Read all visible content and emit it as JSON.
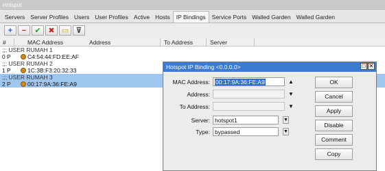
{
  "window": {
    "title": "Hotspot"
  },
  "tabs": [
    "Servers",
    "Server Profiles",
    "Users",
    "User Profiles",
    "Active",
    "Hosts",
    "IP Bindings",
    "Service Ports",
    "Walled Garden",
    "Walled Garden"
  ],
  "active_tab": "IP Bindings",
  "toolbar": {
    "add": "+",
    "remove": "−",
    "enable": "✔",
    "disable": "✖",
    "comment": "▭",
    "filter": "⊽"
  },
  "grid": {
    "headers": [
      "#",
      "MAC Address",
      "Address",
      "To Address",
      "Server"
    ],
    "rows": [
      {
        "comment": ";;; USER RUMAH 1",
        "num": "0",
        "flag": "P",
        "mac": "C4:54:44:FD:EE:AF"
      },
      {
        "comment": ";;; USER RUMAH 2",
        "num": "1",
        "flag": "P",
        "mac": "1C:3B:F3:20:32:33"
      },
      {
        "comment": ";;; USER RUMAH 3",
        "num": "2",
        "flag": "P",
        "mac": "00:17:9A:36:FE:A9"
      }
    ]
  },
  "dialog": {
    "title": "Hotspot IP Binding <0.0.0.0>",
    "mac_label": "MAC Address:",
    "mac_value": "00:17:9A:36:FE:A9",
    "address_label": "Address:",
    "address_value": "",
    "to_address_label": "To Address:",
    "to_address_value": "",
    "server_label": "Server:",
    "server_value": "hotspot1",
    "type_label": "Type:",
    "type_value": "bypassed",
    "buttons": {
      "ok": "OK",
      "cancel": "Cancel",
      "apply": "Apply",
      "disable": "Disable",
      "comment": "Comment",
      "copy": "Copy"
    }
  }
}
